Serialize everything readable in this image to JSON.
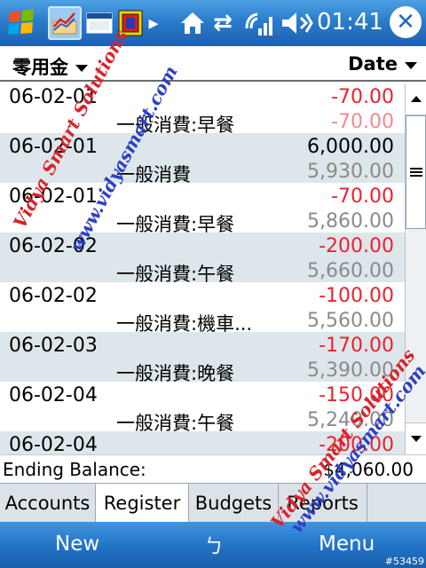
{
  "status_bar": {
    "time": "01:41",
    "icons": [
      "windows-start-icon",
      "money-app-icon",
      "window-icon",
      "red-square-app-icon",
      "more-arrow-icon",
      "home-icon",
      "sync-arrows-icon",
      "signal-icon",
      "volume-icon",
      "close-icon"
    ],
    "close_glyph": "✕",
    "more_glyph": "▸",
    "sync_glyph": "⇄"
  },
  "header": {
    "account": "零用金",
    "sort": "Date"
  },
  "transactions": [
    {
      "date": "06-02-01",
      "amount": "-70.00",
      "category": "一般消費:早餐",
      "balance": "-70.00",
      "amount_type": "neg",
      "balance_type": "neg"
    },
    {
      "date": "06-02-01",
      "amount": "6,000.00",
      "category": "一般消費",
      "balance": "5,930.00",
      "amount_type": "pos",
      "balance_type": "pos"
    },
    {
      "date": "06-02-01",
      "amount": "-70.00",
      "category": "一般消費:早餐",
      "balance": "5,860.00",
      "amount_type": "neg",
      "balance_type": "pos"
    },
    {
      "date": "06-02-02",
      "amount": "-200.00",
      "category": "一般消費:午餐",
      "balance": "5,660.00",
      "amount_type": "neg",
      "balance_type": "pos"
    },
    {
      "date": "06-02-02",
      "amount": "-100.00",
      "category": "一般消費:機車...",
      "balance": "5,560.00",
      "amount_type": "neg",
      "balance_type": "pos"
    },
    {
      "date": "06-02-03",
      "amount": "-170.00",
      "category": "一般消費:晚餐",
      "balance": "5,390.00",
      "amount_type": "neg",
      "balance_type": "pos"
    },
    {
      "date": "06-02-04",
      "amount": "-150.00",
      "category": "一般消費:午餐",
      "balance": "5,240.00",
      "amount_type": "neg",
      "balance_type": "pos"
    },
    {
      "date": "06-02-04",
      "amount": "-200.00",
      "category": "",
      "balance": "",
      "amount_type": "neg",
      "balance_type": "pos"
    }
  ],
  "ending": {
    "label": "Ending Balance:",
    "value": "$4,060.00"
  },
  "tabs": [
    {
      "label": "Accounts",
      "active": false
    },
    {
      "label": "Register",
      "active": true
    },
    {
      "label": "Budgets",
      "active": false
    },
    {
      "label": "Reports",
      "active": false
    }
  ],
  "menu_bar": {
    "left": "New",
    "center": "ㄅ",
    "right": "Menu",
    "image_id": "#53459"
  },
  "watermark": {
    "line1": "Vidya Smart Solutions",
    "line2": "www.vidyasmart.com"
  },
  "colors": {
    "negative": "#e8232f",
    "status_bar": "#2a7ccb",
    "alt_row": "#dde6ea"
  }
}
